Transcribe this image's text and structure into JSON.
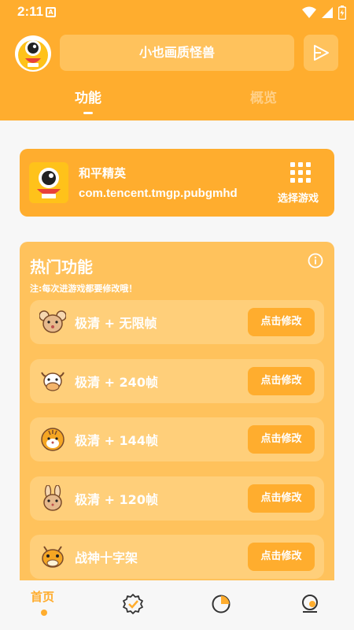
{
  "status": {
    "time": "2:11",
    "notification_icon": "a-notification-icon"
  },
  "header": {
    "title": "小也画质怪兽",
    "tabs": [
      {
        "label": "功能",
        "active": true
      },
      {
        "label": "概览",
        "active": false
      }
    ]
  },
  "game": {
    "name": "和平精英",
    "package": "com.tencent.tmgp.pubgmhd",
    "select_label": "选择游戏"
  },
  "hot": {
    "title": "热门功能",
    "note": "注:每次进游戏都要修改哦！",
    "items": [
      {
        "label": "极清 + 无限帧",
        "button": "点击修改",
        "icon": "rat-icon"
      },
      {
        "label": "极清 + 240帧",
        "button": "点击修改",
        "icon": "ox-icon"
      },
      {
        "label": "极清 + 144帧",
        "button": "点击修改",
        "icon": "tiger-icon"
      },
      {
        "label": "极清 + 120帧",
        "button": "点击修改",
        "icon": "rabbit-icon"
      },
      {
        "label": "战神十字架",
        "button": "点击修改",
        "icon": "dragon-icon"
      }
    ]
  },
  "nav": {
    "home_label": "首页"
  },
  "colors": {
    "accent": "#ffad2e",
    "card": "#ffc25c",
    "row": "#ffcf7a",
    "background": "#f7f7f7"
  }
}
